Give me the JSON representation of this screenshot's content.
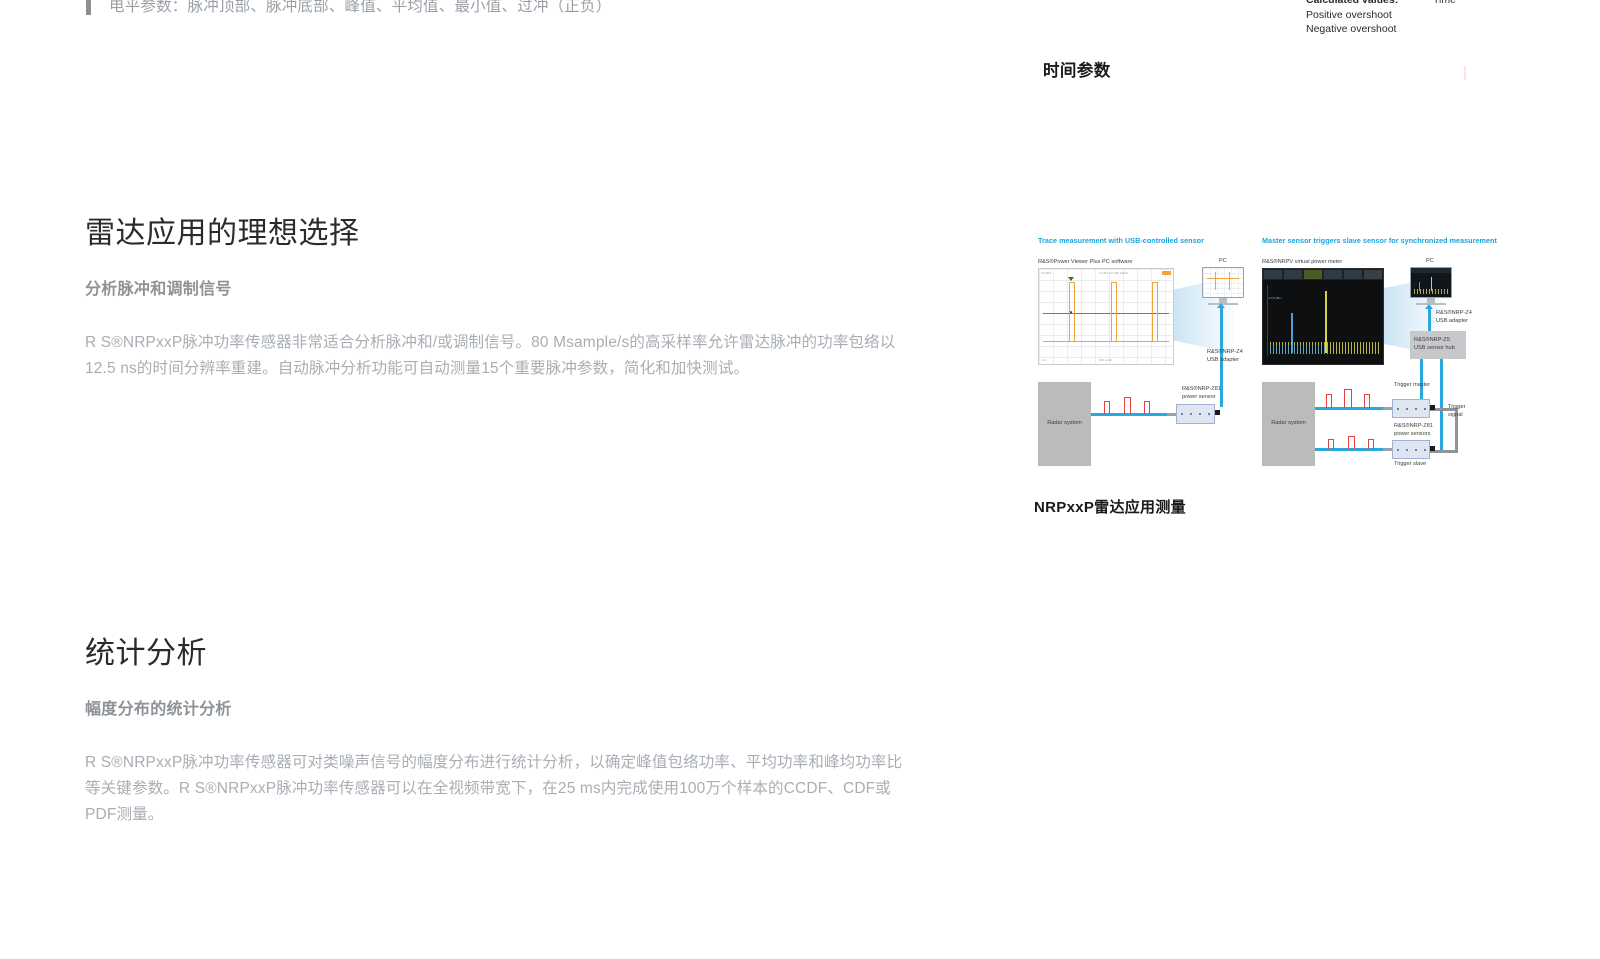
{
  "top_bullet": {
    "text": "电平参数：脉冲顶部、脉冲底部、峰值、平均值、最小值、过冲（正负）"
  },
  "calculated_values": {
    "title": "Calculated values:",
    "items": [
      "Positive overshoot",
      "Negative overshoot"
    ],
    "axis_label": "Time"
  },
  "right_column": {
    "time_params_heading": "时间参数"
  },
  "sections": [
    {
      "id": "radar",
      "title": "雷达应用的理想选择",
      "subtitle": "分析脉冲和调制信号",
      "body": "R S®NRPxxP脉冲功率传感器非常适合分析脉冲和/或调制信号。80 Msample/s的高采样率允许雷达脉冲的功率包络以12.5 ns的时间分辨率重建。自动脉冲分析功能可自动测量15个重要脉冲参数，简化和加快测试。"
    },
    {
      "id": "stats",
      "title": "统计分析",
      "subtitle": "幅度分布的统计分析",
      "body": "R S®NRPxxP脉冲功率传感器可对类噪声信号的幅度分布进行统计分析，以确定峰值包络功率、平均功率和峰均功率比等关键参数。R S®NRPxxP脉冲功率传感器可以在全视频带宽下，在25 ms内完成使用100万个样本的CCDF、CDF或PDF测量。"
    }
  ],
  "figure": {
    "caption": "NRPxxP雷达应用测量",
    "diagram_left": {
      "title": "Trace measurement with USB-controlled sensor",
      "software_label": "R&S®Power Viewer Plus PC software",
      "pc_label": "PC",
      "adapter_label_line1": "R&S®NRP-Z4",
      "adapter_label_line2": "USB adapter",
      "sensor_label_line1": "R&S®NRP-Z81",
      "sensor_label_line2": "power sensor",
      "source_label": "Radar system"
    },
    "diagram_right": {
      "title": "Master sensor triggers slave sensor for synchronized measurement",
      "software_label": "R&S®NRPV virtual power meter",
      "pc_label": "PC",
      "adapter_label_line1": "R&S®NRP-Z4",
      "adapter_label_line2": "USB adapter",
      "hub_label_line1": "R&S®NRP-Z5",
      "hub_label_line2": "USB sensor hub",
      "sensor_label_line1": "R&S®NRP-Z81",
      "sensor_label_line2": "power sensors",
      "trigger_master_label": "Trigger master",
      "trigger_slave_label": "Trigger slave",
      "trigger_signal_line1": "Trigger",
      "trigger_signal_line2": "signal",
      "source_label": "Radar system"
    }
  },
  "colors": {
    "accent_blue": "#19a3dc",
    "cable_blue": "#29a8e0",
    "pulse_red": "#e8403f",
    "body_gray": "#a8aeb4",
    "subtitle_gray": "#8d9297",
    "heading_dark": "#2b2b2b"
  }
}
